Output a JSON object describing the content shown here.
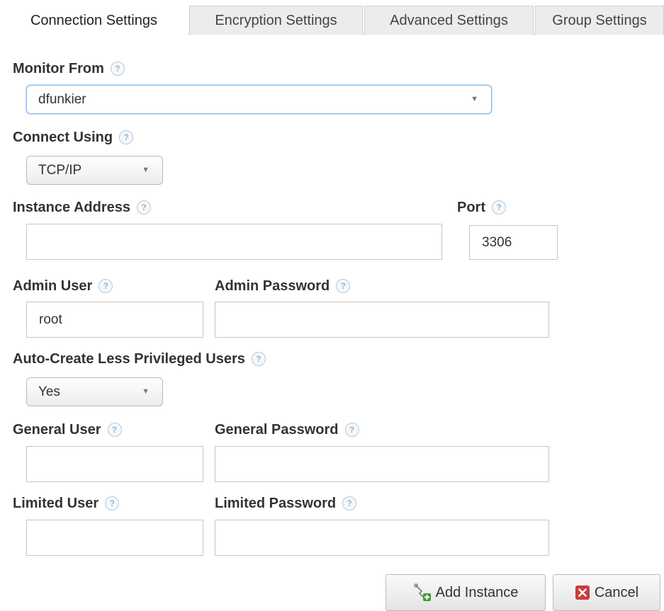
{
  "tabs": [
    {
      "label": "Connection Settings",
      "active": true
    },
    {
      "label": "Encryption Settings",
      "active": false
    },
    {
      "label": "Advanced Settings",
      "active": false
    },
    {
      "label": "Group Settings",
      "active": false
    }
  ],
  "form": {
    "monitor_from": {
      "label": "Monitor From",
      "value": "dfunkier"
    },
    "connect_using": {
      "label": "Connect Using",
      "value": "TCP/IP"
    },
    "instance_address": {
      "label": "Instance Address",
      "value": ""
    },
    "port": {
      "label": "Port",
      "value": "3306"
    },
    "admin_user": {
      "label": "Admin User",
      "value": "root"
    },
    "admin_password": {
      "label": "Admin Password",
      "value": ""
    },
    "auto_create": {
      "label": "Auto-Create Less Privileged Users",
      "value": "Yes"
    },
    "general_user": {
      "label": "General User",
      "value": ""
    },
    "general_password": {
      "label": "General Password",
      "value": ""
    },
    "limited_user": {
      "label": "Limited User",
      "value": ""
    },
    "limited_password": {
      "label": "Limited Password",
      "value": ""
    },
    "help_glyph": "?"
  },
  "buttons": {
    "add_instance": {
      "label": "Add Instance",
      "icon": "add-server-icon"
    },
    "cancel": {
      "label": "Cancel",
      "icon": "red-x-icon"
    }
  },
  "colors": {
    "focus_border": "#7db3e8",
    "help_icon": "#b5c9da",
    "cancel_icon": "#cc3b3b",
    "add_icon_plus": "#4a9a2e"
  }
}
